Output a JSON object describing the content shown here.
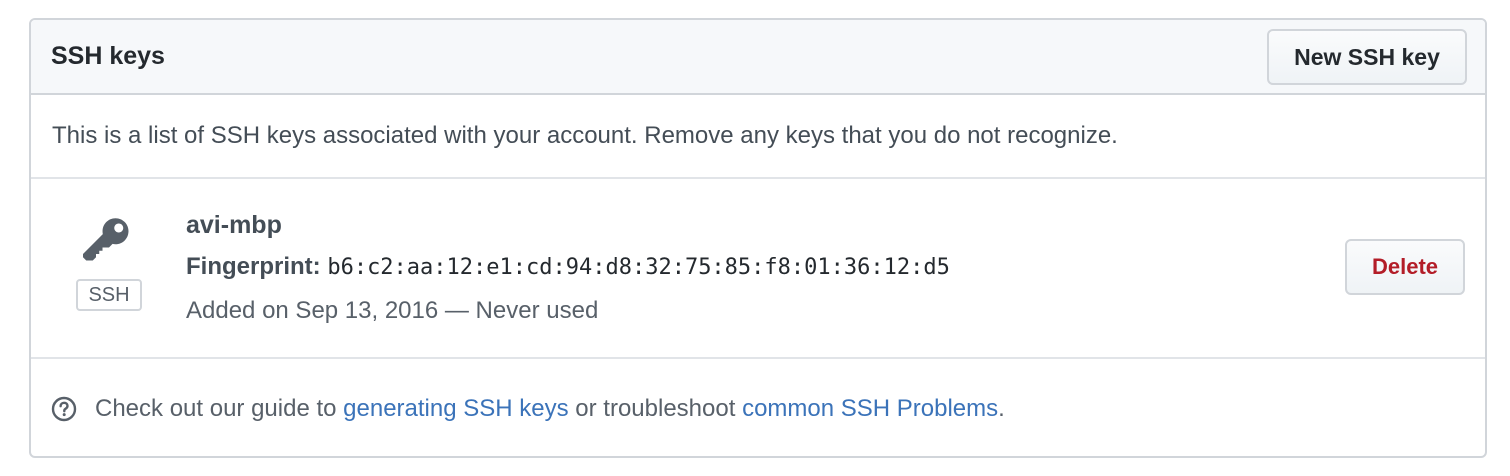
{
  "panel": {
    "title": "SSH keys",
    "new_key_button": "New SSH key",
    "intro": "This is a list of SSH keys associated with your account. Remove any keys that you do not recognize."
  },
  "keys": [
    {
      "title": "avi-mbp",
      "badge": "SSH",
      "fingerprint_label": "Fingerprint:",
      "fingerprint": "b6:c2:aa:12:e1:cd:94:d8:32:75:85:f8:01:36:12:d5",
      "added": "Added on Sep 13, 2016 — Never used",
      "delete_label": "Delete"
    }
  ],
  "footer": {
    "prefix": "Check out our guide to ",
    "link1": "generating SSH keys",
    "middle": " or troubleshoot ",
    "link2": "common SSH Problems",
    "suffix": "."
  },
  "icons": {
    "key": "key-icon",
    "help": "question-circle-icon"
  },
  "colors": {
    "link": "#3b73b9",
    "danger": "#b31d28",
    "header_bg": "#f6f8fa",
    "border": "#d1d5da"
  }
}
